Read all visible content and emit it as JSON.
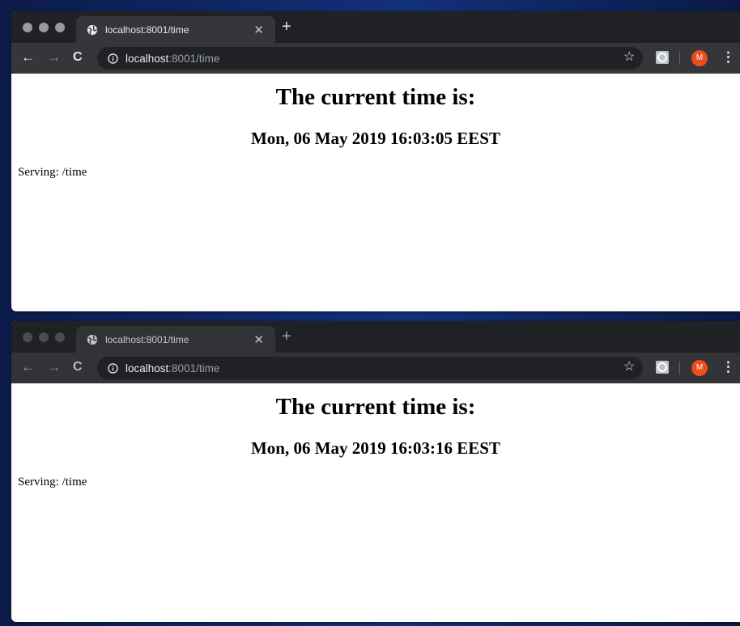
{
  "windows": [
    {
      "tab_title": "localhost:8001/time",
      "url_host": "localhost",
      "url_path": ":8001/time",
      "heading": "The current time is:",
      "time": "Mon, 06 May 2019 16:03:05 EEST",
      "serving": "Serving: /time",
      "avatar_letter": "M",
      "state": "active"
    },
    {
      "tab_title": "localhost:8001/time",
      "url_host": "localhost",
      "url_path": ":8001/time",
      "heading": "The current time is:",
      "time": "Mon, 06 May 2019 16:03:16 EEST",
      "serving": "Serving: /time",
      "avatar_letter": "M",
      "state": "inactive"
    }
  ],
  "icons": {
    "back": "back-arrow-icon",
    "forward": "forward-arrow-icon",
    "reload": "reload-icon",
    "info": "info-icon",
    "star": "bookmark-star-icon",
    "extension": "extension-icon",
    "menu": "kebab-menu-icon",
    "new_tab": "plus-icon",
    "close_tab": "close-icon",
    "favicon": "globe-icon"
  },
  "colors": {
    "chrome_dark": "#202124",
    "toolbar": "#35363a",
    "avatar": "#ea4e1b",
    "desktop": "#12307a"
  }
}
